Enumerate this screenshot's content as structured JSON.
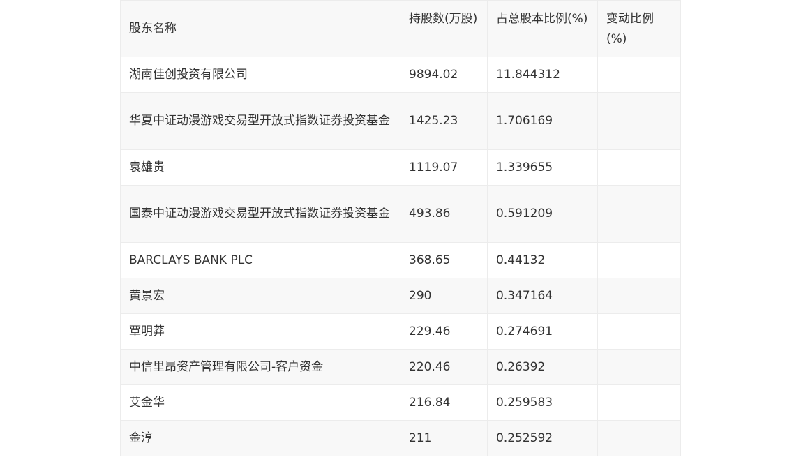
{
  "table": {
    "headers": [
      "股东名称",
      "持股数(万股)",
      "占总股本比例(%)",
      "变动比例(%)"
    ],
    "rows": [
      [
        "湖南佳创投资有限公司",
        "9894.02",
        "11.844312",
        ""
      ],
      [
        "华夏中证动漫游戏交易型开放式指数证券投资基金",
        "1425.23",
        "1.706169",
        ""
      ],
      [
        "袁雄贵",
        "1119.07",
        "1.339655",
        ""
      ],
      [
        "国泰中证动漫游戏交易型开放式指数证券投资基金",
        "493.86",
        "0.591209",
        ""
      ],
      [
        "BARCLAYS BANK PLC",
        "368.65",
        "0.44132",
        ""
      ],
      [
        "黄景宏",
        "290",
        "0.347164",
        ""
      ],
      [
        "覃明莽",
        "229.46",
        "0.274691",
        ""
      ],
      [
        "中信里昂资产管理有限公司-客户资金",
        "220.46",
        "0.26392",
        ""
      ],
      [
        "艾金华",
        "216.84",
        "0.259583",
        ""
      ],
      [
        "金淳",
        "211",
        "0.252592",
        ""
      ]
    ]
  }
}
